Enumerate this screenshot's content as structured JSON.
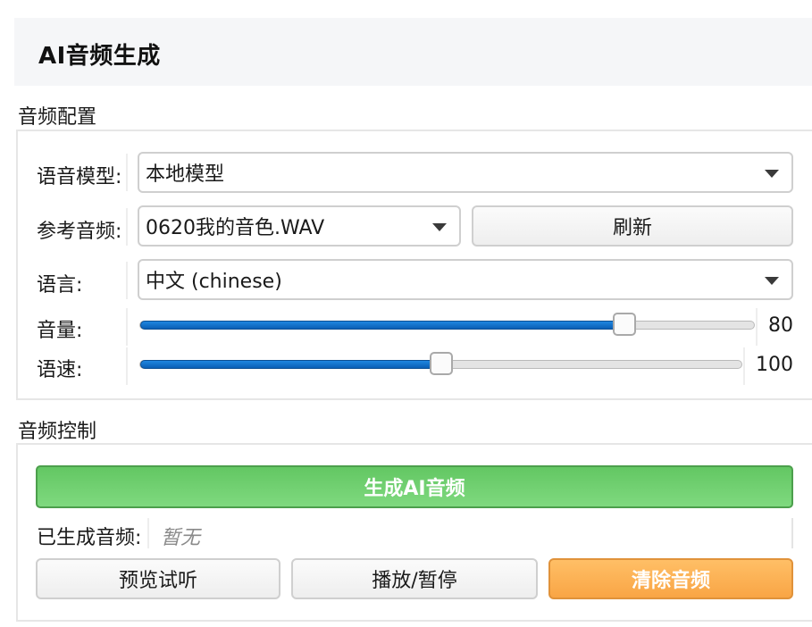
{
  "header": {
    "title": "AI音频生成"
  },
  "config": {
    "section_label": "音频配置",
    "voice_model": {
      "label": "语音模型:",
      "value": "本地模型"
    },
    "reference_audio": {
      "label": "参考音频:",
      "value": "0620我的音色.WAV",
      "refresh_label": "刷新"
    },
    "language": {
      "label": "语言:",
      "value": "中文 (chinese)"
    },
    "volume": {
      "label": "音量:",
      "value": "80",
      "fraction": 0.8
    },
    "speed": {
      "label": "语速:",
      "value": "100",
      "fraction": 0.5
    }
  },
  "control": {
    "section_label": "音频控制",
    "generate_label": "生成AI音频",
    "generated": {
      "label": "已生成音频:",
      "value": "暂无"
    },
    "preview_label": "预览试听",
    "play_pause_label": "播放/暂停",
    "clear_label": "清除音频"
  },
  "colors": {
    "accent_blue": "#1f86e0",
    "generate_green": "#6ccf6c",
    "clear_orange": "#fbb055"
  }
}
